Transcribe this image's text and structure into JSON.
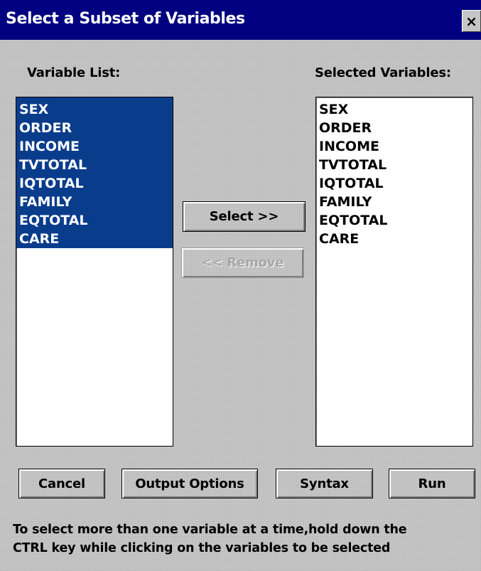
{
  "window": {
    "title": "Select a Subset of Variables",
    "close_label": "×"
  },
  "variable_list": {
    "label": "Variable List:",
    "items": [
      "SEX",
      "ORDER",
      "INCOME",
      "TVTOTAL",
      "IQTOTAL",
      "FAMILY",
      "EQTOTAL",
      "CARE"
    ],
    "all_selected": true
  },
  "selected_variables": {
    "label": "Selected Variables:",
    "items": [
      "SEX",
      "ORDER",
      "INCOME",
      "TVTOTAL",
      "IQTOTAL",
      "FAMILY",
      "EQTOTAL",
      "CARE"
    ]
  },
  "buttons": {
    "select": "Select >>",
    "remove": "<< Remove",
    "cancel": "Cancel",
    "output_options": "Output Options",
    "syntax": "Syntax",
    "run": "Run"
  },
  "help": {
    "line1": "To select more than one variable at a time,hold down the",
    "line2": "CTRL key while clicking on the variables to be selected"
  },
  "colors": {
    "titlebar": "#000080",
    "selection": "#0a3c8c"
  }
}
